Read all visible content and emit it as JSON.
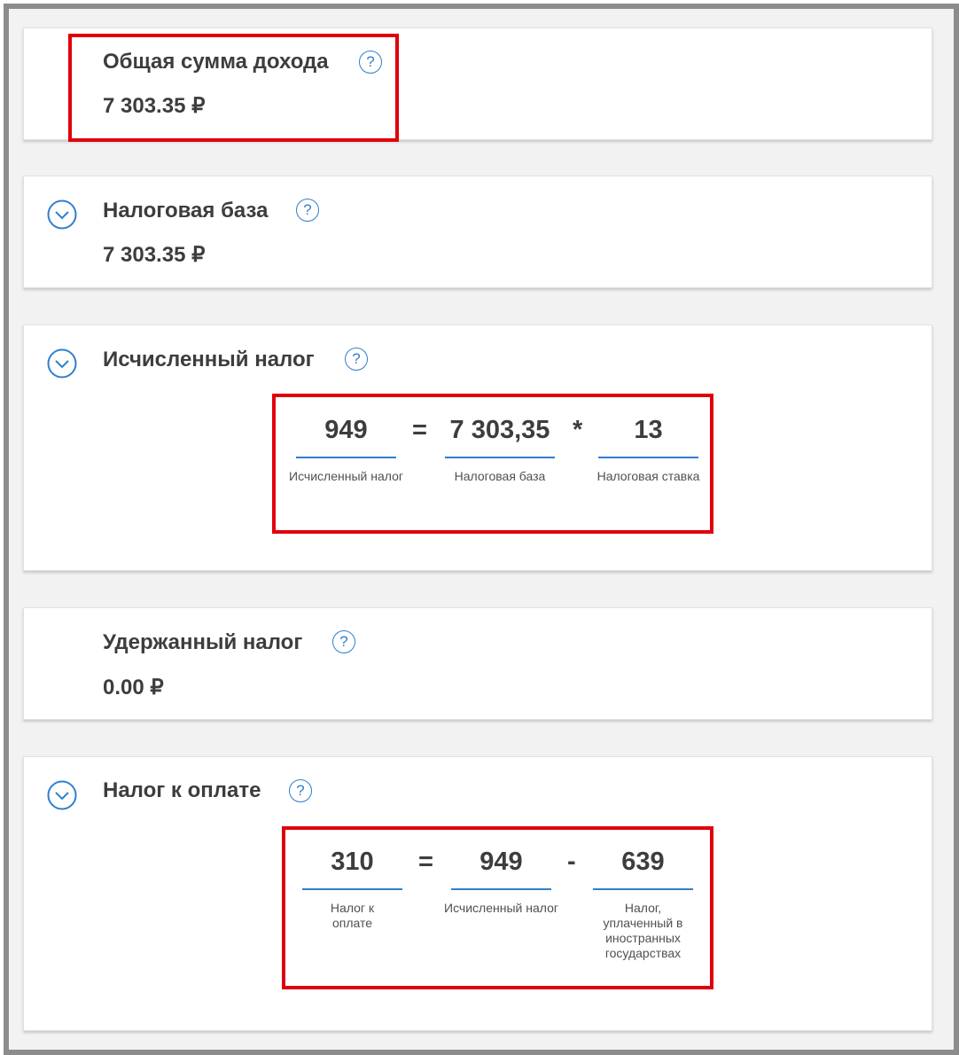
{
  "cards": {
    "total_income": {
      "title": "Общая сумма дохода",
      "value": "7 303.35 ₽"
    },
    "tax_base": {
      "title": "Налоговая база",
      "value": "7 303.35 ₽"
    },
    "calculated_tax": {
      "title": "Исчисленный налог",
      "formula": {
        "result": "949",
        "result_label": "Исчисленный налог",
        "op1": "=",
        "operand1": "7 303,35",
        "operand1_label": "Налоговая база",
        "op2": "*",
        "operand2": "13",
        "operand2_label": "Налоговая ставка"
      }
    },
    "withheld_tax": {
      "title": "Удержанный налог",
      "value": "0.00 ₽"
    },
    "tax_due": {
      "title": "Налог к оплате",
      "formula": {
        "result": "310",
        "result_label": "Налог к оплате",
        "op1": "=",
        "operand1": "949",
        "operand1_label": "Исчисленный налог",
        "op2": "-",
        "operand2": "639",
        "operand2_label": "Налог, уплаченный в иностранных государствах"
      }
    }
  },
  "icons": {
    "help": "question-circle-icon",
    "expand": "chevron-down-circle-icon",
    "help_glyph": "?"
  },
  "colors": {
    "accent": "#2f7fcf",
    "highlight": "#e0000b",
    "text": "#3d3d3d"
  }
}
